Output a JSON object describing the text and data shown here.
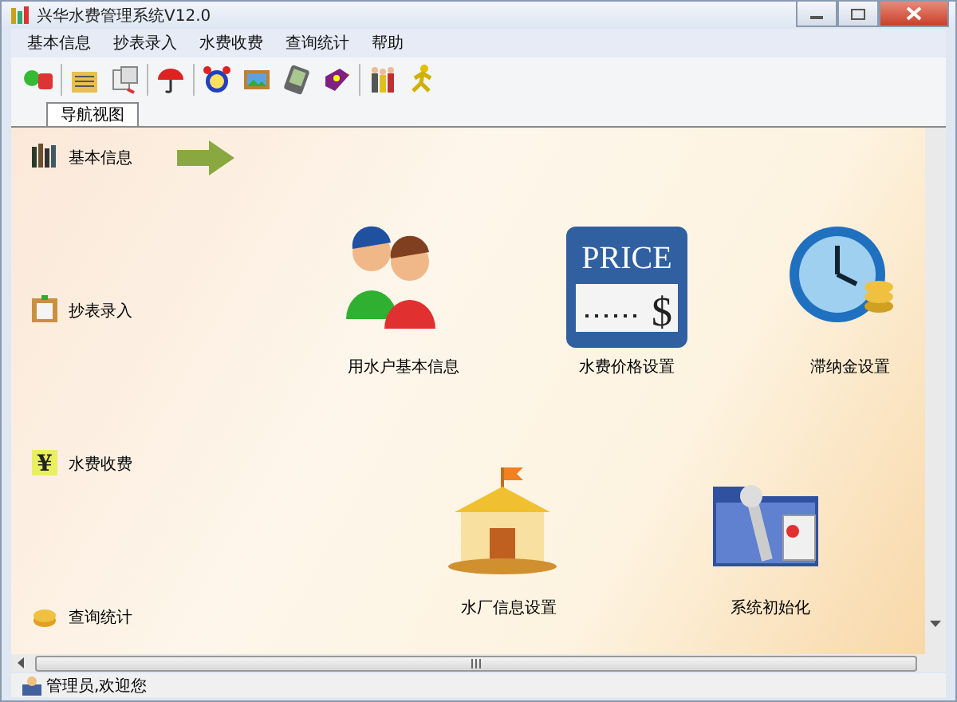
{
  "window": {
    "title": "兴华水费管理系统V12.0"
  },
  "menu": [
    "基本信息",
    "抄表录入",
    "水费收费",
    "查询统计",
    "帮助"
  ],
  "tabs": [
    {
      "label": "导航视图",
      "selected": true
    }
  ],
  "sidebar": {
    "items": [
      {
        "label": "基本信息",
        "kind": "books",
        "selected": true
      },
      {
        "label": "抄表录入",
        "kind": "clipboard",
        "selected": false
      },
      {
        "label": "水费收费",
        "kind": "yen",
        "icon_text": "¥",
        "selected": false
      },
      {
        "label": "查询统计",
        "kind": "coins",
        "selected": false
      }
    ]
  },
  "modules": [
    {
      "label": "用水户基本信息",
      "kind": "users"
    },
    {
      "label": "水费价格设置",
      "kind": "price",
      "sign": "PRICE",
      "amount": "$"
    },
    {
      "label": "滞纳金设置",
      "kind": "clock"
    },
    {
      "label": "水厂信息设置",
      "kind": "factory"
    },
    {
      "label": "系统初始化",
      "kind": "tools"
    }
  ],
  "status_bar": {
    "text": "管理员,欢迎您"
  }
}
